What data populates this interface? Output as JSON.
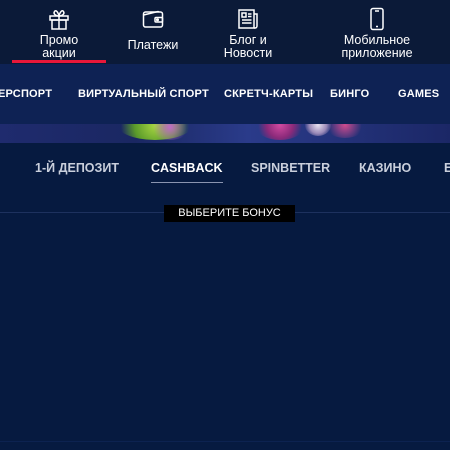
{
  "top_nav": {
    "items": [
      {
        "label_line1": "Промо",
        "label_line2": "акции",
        "icon": "gift-icon",
        "active": true
      },
      {
        "label_line1": "Платежи",
        "label_line2": "",
        "icon": "wallet-icon",
        "active": false
      },
      {
        "label_line1": "Блог и",
        "label_line2": "Новости",
        "icon": "news-icon",
        "active": false
      },
      {
        "label_line1": "Мобильное",
        "label_line2": "приложение",
        "icon": "smartphone-icon",
        "active": false
      }
    ],
    "accent_color": "#e8173a"
  },
  "sport_nav": {
    "items": [
      "ЕРСПОРТ",
      "ВИРТУАЛЬНЫЙ СПОРТ",
      "СКРЕТЧ-КАРТЫ",
      "БИНГО",
      "GAMES"
    ]
  },
  "bonus_tabs": {
    "items": [
      "1-Й ДЕПОЗИТ",
      "CASHBACK",
      "SPINBETTER",
      "КАЗИНО",
      "Е"
    ],
    "active": "CASHBACK"
  },
  "choose_bonus": {
    "label": "ВЫБЕРИТЕ БОНУС"
  },
  "colors": {
    "background": "#061a40",
    "sport_nav": "#0e2254",
    "top_nav": "#0b1a38"
  }
}
